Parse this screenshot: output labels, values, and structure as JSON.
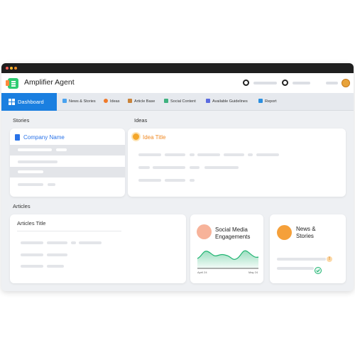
{
  "app": {
    "title": "Amplifier Agent"
  },
  "nav": {
    "active": "Dashboard",
    "items": [
      {
        "label": "News & Stories",
        "icon": "megaphone-icon",
        "color": "#4aa3f0"
      },
      {
        "label": "Ideas",
        "icon": "lightbulb-icon",
        "color": "#f07a2a"
      },
      {
        "label": "Article Base",
        "icon": "book-icon",
        "color": "#c9833a"
      },
      {
        "label": "Social Content",
        "icon": "share-icon",
        "color": "#3fb27f"
      },
      {
        "label": "Available Guidelines",
        "icon": "guidelines-icon",
        "color": "#5b6be0"
      },
      {
        "label": "Report",
        "icon": "report-icon",
        "color": "#2a8fe0"
      }
    ]
  },
  "sections": {
    "stories": "Stories",
    "ideas": "Ideas",
    "articles": "Articles"
  },
  "stories": {
    "company": "Company Name"
  },
  "ideas": {
    "title": "Idea Title"
  },
  "articles": {
    "title": "Articles Title"
  },
  "social": {
    "title_line1": "Social Media",
    "title_line2": "Engagements",
    "date_start": "April 24",
    "date_end": "May 24"
  },
  "news": {
    "title_line1": "News &",
    "title_line2": "Stories"
  },
  "colors": {
    "accent": "#1a7fe0",
    "chart": "#22b573",
    "orange": "#f08a24",
    "peach": "#f7b39a"
  }
}
